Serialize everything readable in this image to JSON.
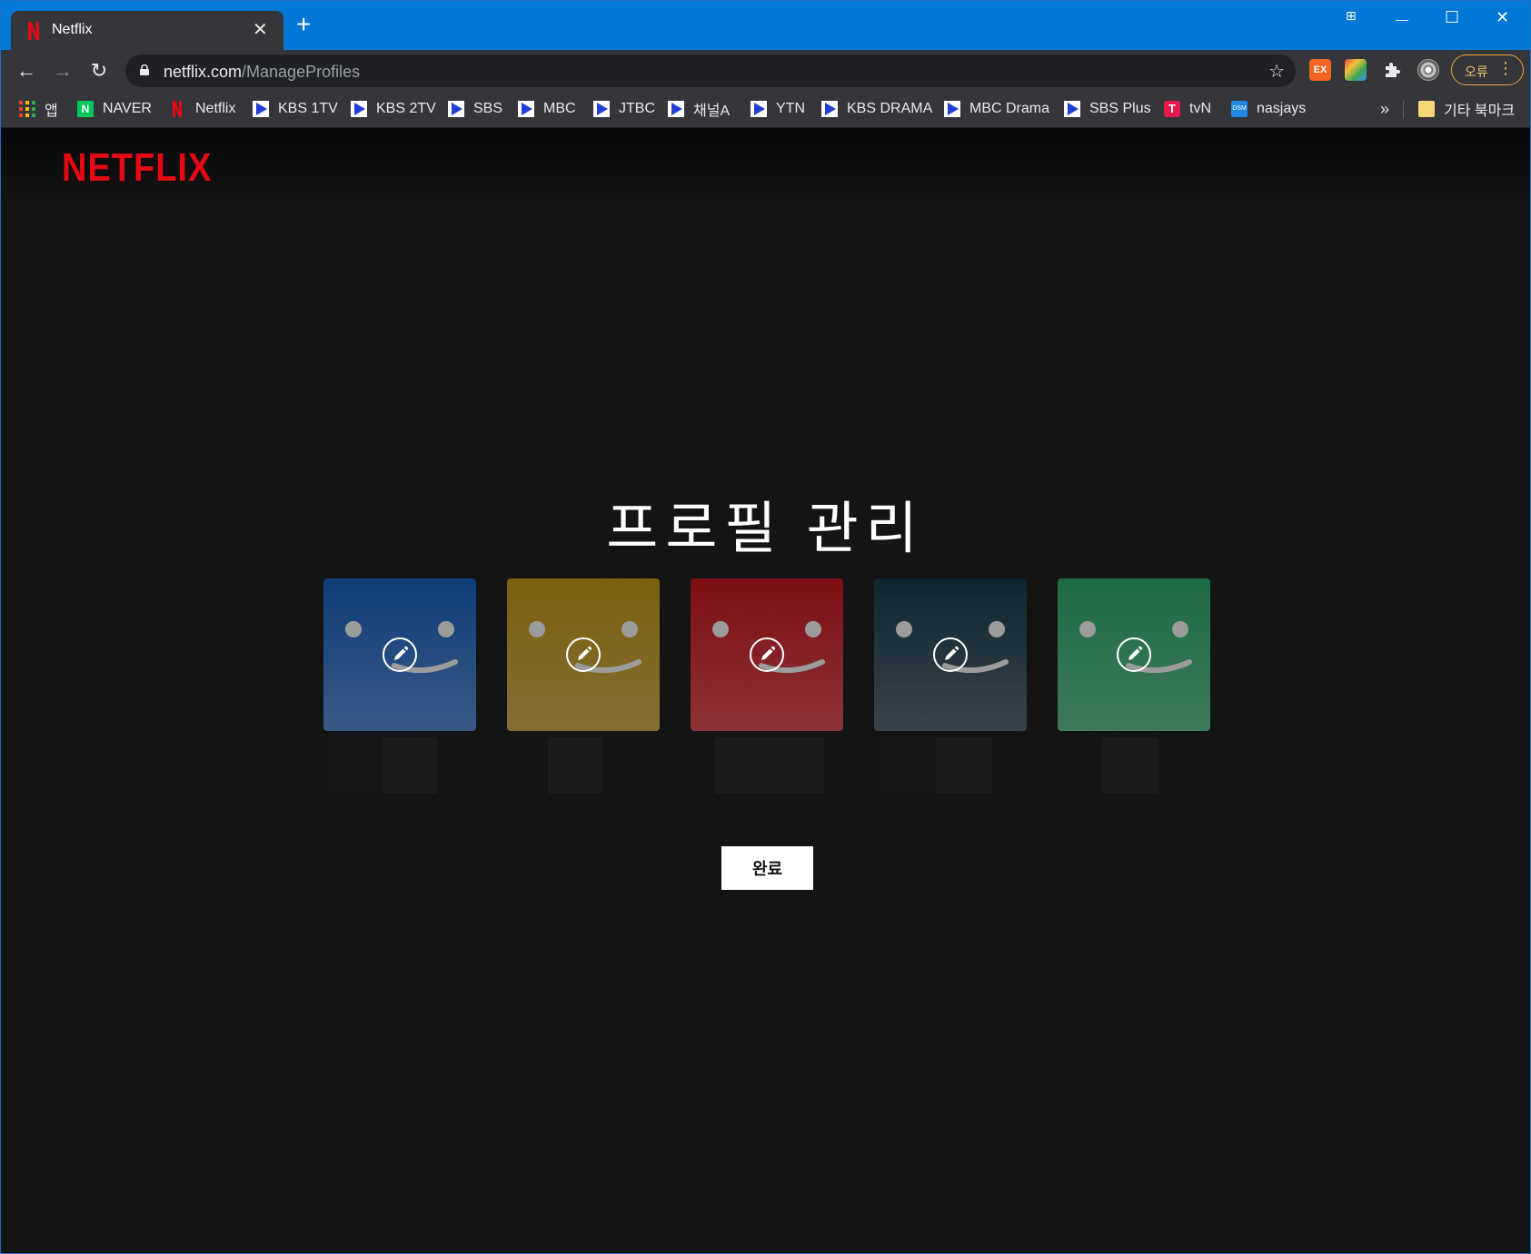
{
  "browser": {
    "tab": {
      "title": "Netflix",
      "close_glyph": "✕"
    },
    "new_tab_glyph": "+",
    "window_controls": {
      "snap": "⊞",
      "minimize": "—",
      "maximize": "☐",
      "close": "✕"
    },
    "nav": {
      "back": "←",
      "forward": "→",
      "reload": "↻"
    },
    "url": {
      "host": "netflix.com",
      "path": "/ManageProfiles"
    },
    "bookmark_star": "☆",
    "error_button": {
      "label": "오류",
      "menu_glyph": "⋮"
    },
    "extensions": [
      {
        "name": "ex-extension-icon",
        "label": "EX",
        "color": "#f26522"
      },
      {
        "name": "cast-extension-icon",
        "label": "",
        "color": "#e34a3a"
      },
      {
        "name": "puzzle-extension-icon",
        "label": "",
        "color": "#e8eaed"
      },
      {
        "name": "profile-avatar-icon",
        "label": "",
        "color": "#bdbdbd"
      }
    ],
    "bookmarks": [
      {
        "label": "앱",
        "icon": "apps"
      },
      {
        "label": "NAVER",
        "icon": "naver"
      },
      {
        "label": "Netflix",
        "icon": "netflix"
      },
      {
        "label": "KBS 1TV",
        "icon": "play"
      },
      {
        "label": "KBS 2TV",
        "icon": "play"
      },
      {
        "label": "SBS",
        "icon": "play"
      },
      {
        "label": "MBC",
        "icon": "play"
      },
      {
        "label": "JTBC",
        "icon": "play"
      },
      {
        "label": "채널A",
        "icon": "play"
      },
      {
        "label": "YTN",
        "icon": "play"
      },
      {
        "label": "KBS DRAMA",
        "icon": "play"
      },
      {
        "label": "MBC Drama",
        "icon": "play"
      },
      {
        "label": "SBS Plus",
        "icon": "play"
      },
      {
        "label": "tvN",
        "icon": "tvn"
      },
      {
        "label": "nasjays",
        "icon": "dsm"
      }
    ],
    "bookmarks_overflow": "»",
    "other_bookmarks": "기타 북마크"
  },
  "page": {
    "logo": "NETFLIX",
    "heading": "프로필 관리",
    "profiles": [
      {
        "color_top": "#0e3d78",
        "color_bottom": "#3a5a86"
      },
      {
        "color_top": "#7a600e",
        "color_bottom": "#856e35"
      },
      {
        "color_top": "#7d0f14",
        "color_bottom": "#8c3337"
      },
      {
        "color_top": "#0e2630",
        "color_bottom": "#38444c"
      },
      {
        "color_top": "#1c6b43",
        "color_bottom": "#3f7a5a"
      }
    ],
    "done_label": "완료"
  },
  "colors": {
    "brand": "#e50914",
    "titlebar": "#0078d7",
    "chrome": "#35363a",
    "page_bg": "#141414"
  }
}
